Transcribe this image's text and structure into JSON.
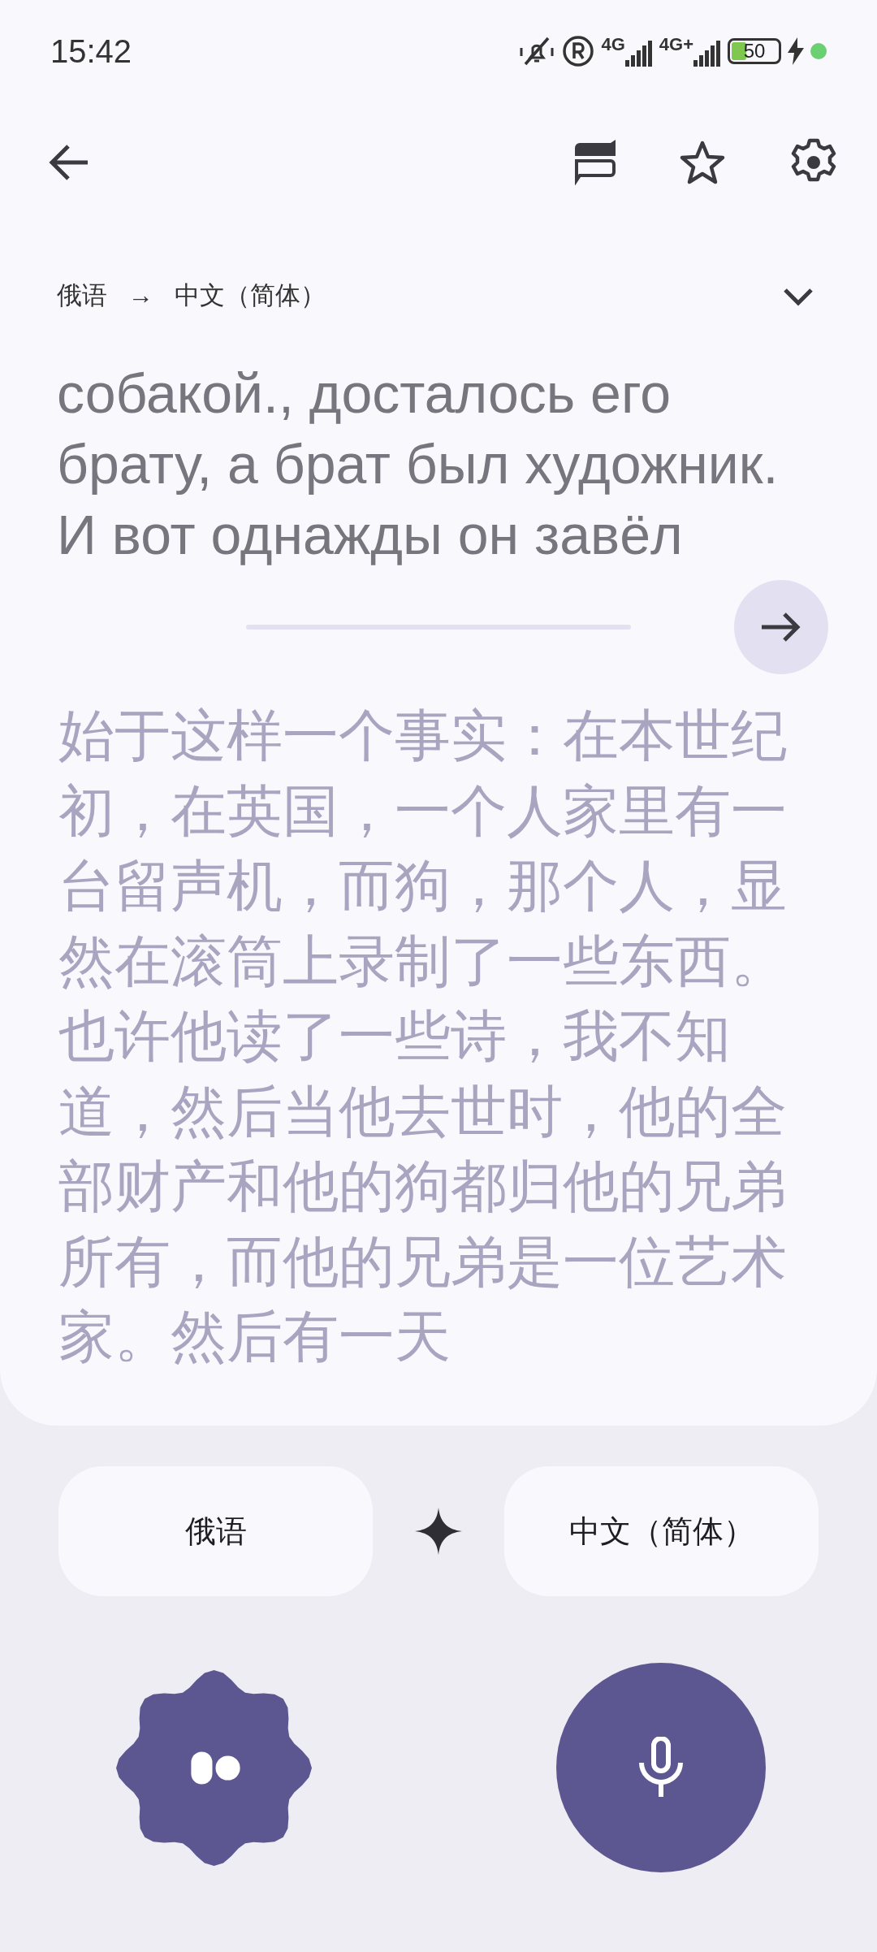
{
  "status_bar": {
    "time": "15:42",
    "network_1": "4G",
    "network_2": "4G+",
    "battery": "50"
  },
  "language_pair": {
    "source": "俄语",
    "arrow": "→",
    "target": "中文（简体）"
  },
  "source_lines": [
    "собакой., досталось его",
    "брату, а брат был художник.",
    "И вот однажды он завёл"
  ],
  "translation_lines": [
    "始于这样一个事实：在本世纪",
    "初，在英国，一个人家里有一",
    "台留声机，而狗，那个人，显",
    "然在滚筒上录制了一些东西。",
    "也许他读了一些诗，我不知",
    "道，然后当他去世时，他的全",
    "部财产和他的狗都归他的兄弟",
    "所有，而他的兄弟是一位艺术",
    "家。然后有一天"
  ],
  "language_buttons": [
    {
      "label": "俄语"
    },
    {
      "label": "中文（简体）"
    }
  ]
}
